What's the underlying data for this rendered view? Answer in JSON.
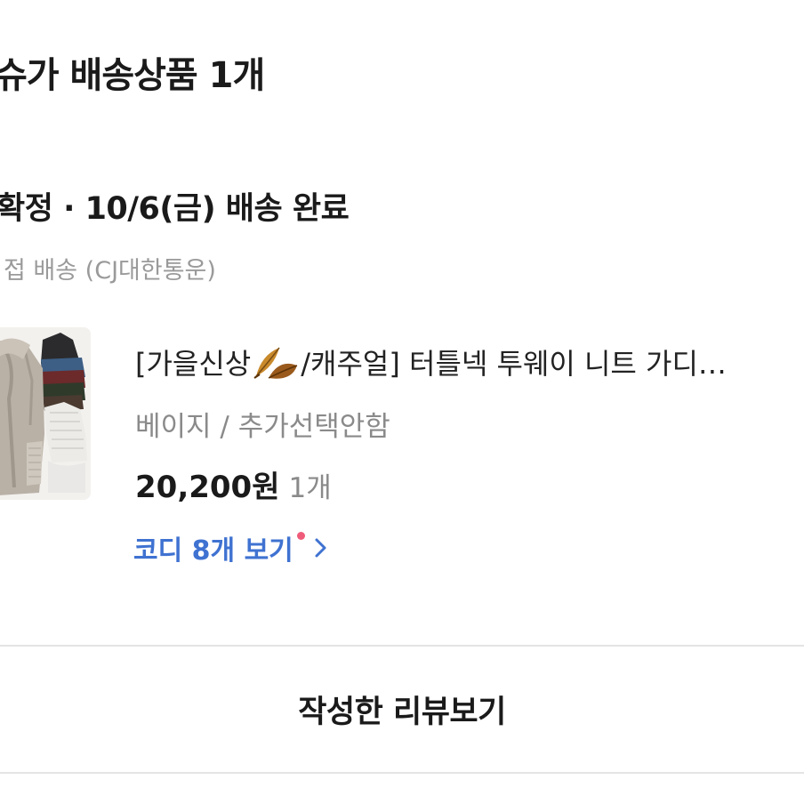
{
  "seller": {
    "title": "슈가 배송상품 1개"
  },
  "delivery": {
    "status": "확정 · 10/6(금) 배송 완료",
    "method": "접 배송 (CJ대한통운)"
  },
  "product": {
    "name_prefix": "[가을신상",
    "name_suffix": "/캐주얼] 터틀넥 투웨이 니트 가디…",
    "leaf_icon": "autumn-leaves-emoji",
    "option": "베이지 / 추가선택안함",
    "price": "20,200원",
    "quantity": "1개",
    "thumbnail_icon": "knit-cardigan-photo"
  },
  "codi": {
    "label": "코디 8개 보기",
    "link_color": "#3f72d1",
    "dot_color": "#ef5c7a"
  },
  "review": {
    "button_label": "작성한 리뷰보기"
  }
}
